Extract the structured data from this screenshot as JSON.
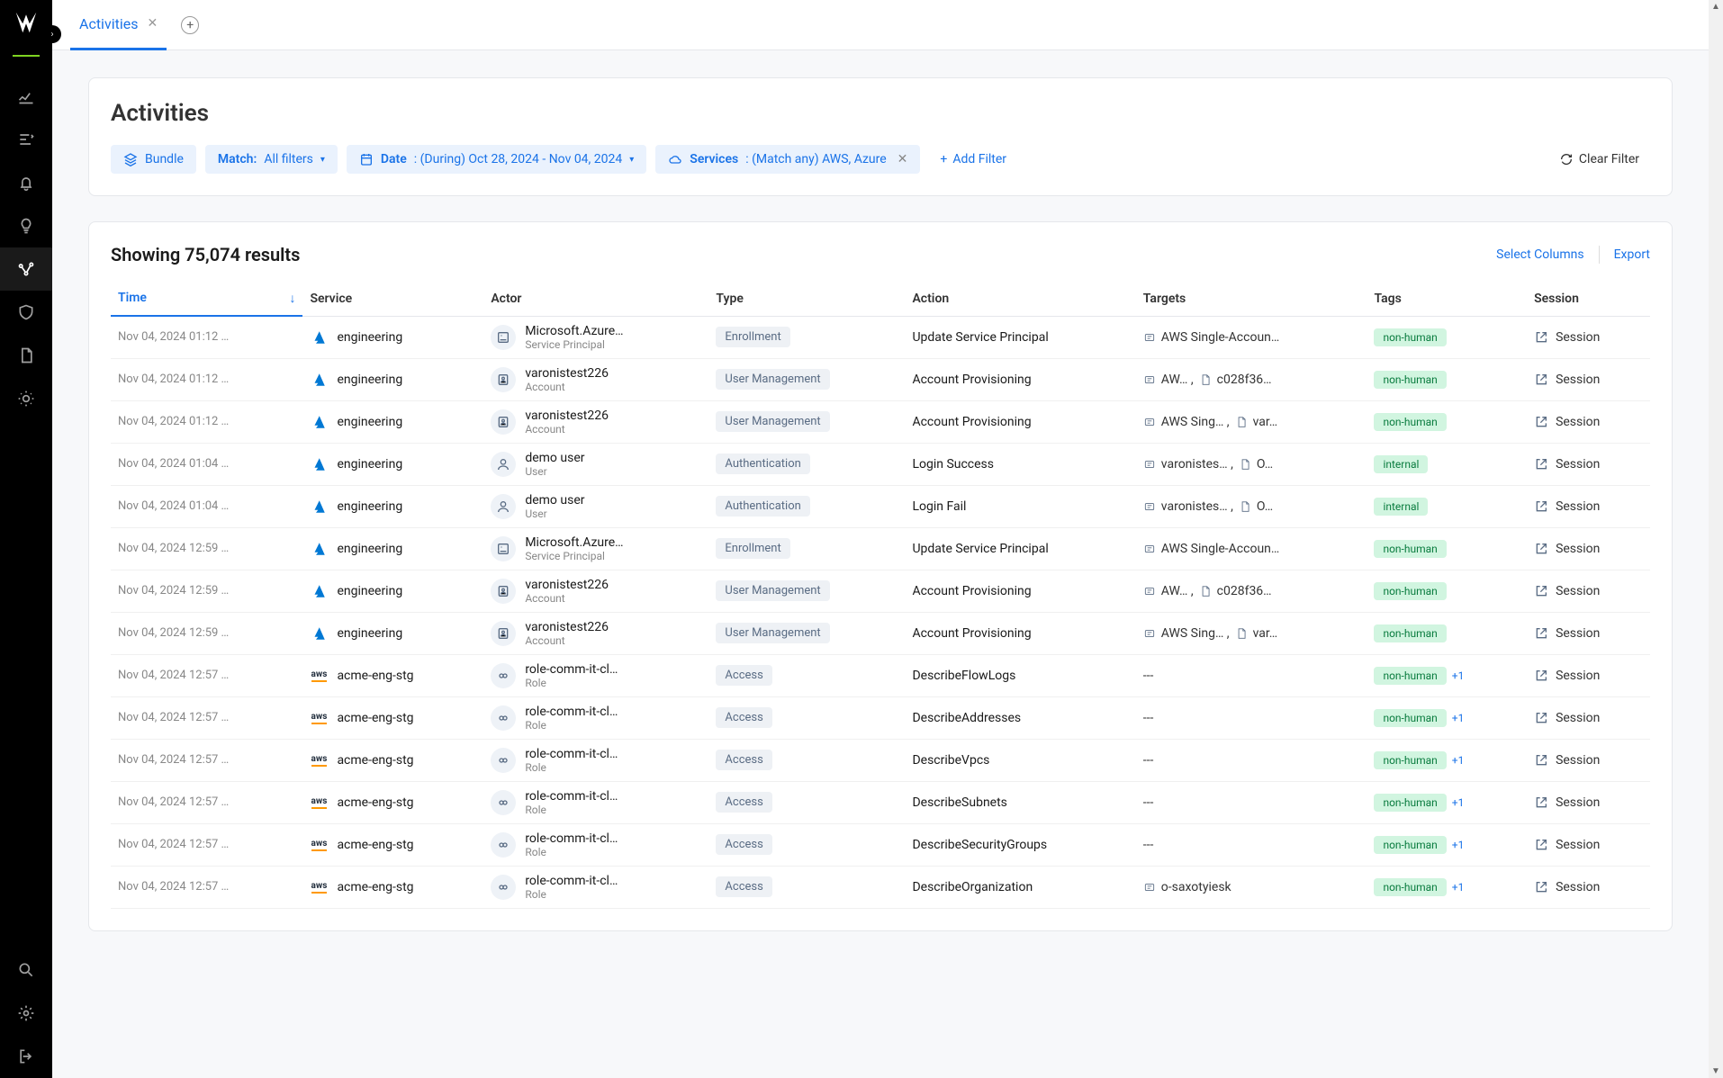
{
  "tab": {
    "label": "Activities"
  },
  "page": {
    "title": "Activities"
  },
  "filters": {
    "bundle": "Bundle",
    "match": {
      "label": "Match:",
      "value": "All filters"
    },
    "date": {
      "label": "Date",
      "value": ": (During) Oct 28, 2024 - Nov 04, 2024"
    },
    "services": {
      "label": "Services",
      "value": ": (Match any) AWS, Azure"
    },
    "add": "Add Filter",
    "clear": "Clear Filter"
  },
  "results": {
    "count_text": "Showing 75,074 results",
    "select_columns": "Select Columns",
    "export": "Export"
  },
  "columns": {
    "time": "Time",
    "service": "Service",
    "actor": "Actor",
    "type": "Type",
    "action": "Action",
    "targets": "Targets",
    "tags": "Tags",
    "session": "Session"
  },
  "session_label": "Session",
  "rows": [
    {
      "time": "Nov 04, 2024 01:12 …",
      "svc": "azure",
      "service": "engineering",
      "actor": "Microsoft.Azure…",
      "actor_sub": "Service Principal",
      "actor_icon": "app",
      "type": "Enrollment",
      "action": "Update Service Principal",
      "targets": "AWS Single-Accoun…",
      "targets2": "",
      "tag": "non-human",
      "plus": ""
    },
    {
      "time": "Nov 04, 2024 01:12 …",
      "svc": "azure",
      "service": "engineering",
      "actor": "varonistest226",
      "actor_sub": "Account",
      "actor_icon": "account",
      "type": "User Management",
      "action": "Account Provisioning",
      "targets": "AW…  ,",
      "targets2": "c028f36…",
      "tag": "non-human",
      "plus": ""
    },
    {
      "time": "Nov 04, 2024 01:12 …",
      "svc": "azure",
      "service": "engineering",
      "actor": "varonistest226",
      "actor_sub": "Account",
      "actor_icon": "account",
      "type": "User Management",
      "action": "Account Provisioning",
      "targets": "AWS Sing… ,",
      "targets2": "var…",
      "tag": "non-human",
      "plus": ""
    },
    {
      "time": "Nov 04, 2024 01:04 …",
      "svc": "azure",
      "service": "engineering",
      "actor": "demo user",
      "actor_sub": "User",
      "actor_icon": "user",
      "type": "Authentication",
      "action": "Login Success",
      "targets": "varonistes… ,",
      "targets2": "O…",
      "tag": "internal",
      "plus": ""
    },
    {
      "time": "Nov 04, 2024 01:04 …",
      "svc": "azure",
      "service": "engineering",
      "actor": "demo user",
      "actor_sub": "User",
      "actor_icon": "user",
      "type": "Authentication",
      "action": "Login Fail",
      "targets": "varonistes… ,",
      "targets2": "O…",
      "tag": "internal",
      "plus": ""
    },
    {
      "time": "Nov 04, 2024 12:59 …",
      "svc": "azure",
      "service": "engineering",
      "actor": "Microsoft.Azure…",
      "actor_sub": "Service Principal",
      "actor_icon": "app",
      "type": "Enrollment",
      "action": "Update Service Principal",
      "targets": "AWS Single-Accoun…",
      "targets2": "",
      "tag": "non-human",
      "plus": ""
    },
    {
      "time": "Nov 04, 2024 12:59 …",
      "svc": "azure",
      "service": "engineering",
      "actor": "varonistest226",
      "actor_sub": "Account",
      "actor_icon": "account",
      "type": "User Management",
      "action": "Account Provisioning",
      "targets": "AW… ,",
      "targets2": "c028f36…",
      "tag": "non-human",
      "plus": ""
    },
    {
      "time": "Nov 04, 2024 12:59 …",
      "svc": "azure",
      "service": "engineering",
      "actor": "varonistest226",
      "actor_sub": "Account",
      "actor_icon": "account",
      "type": "User Management",
      "action": "Account Provisioning",
      "targets": "AWS Sing… ,",
      "targets2": "var…",
      "tag": "non-human",
      "plus": ""
    },
    {
      "time": "Nov 04, 2024 12:57 …",
      "svc": "aws",
      "service": "acme-eng-stg",
      "actor": "role-comm-it-cl…",
      "actor_sub": "Role",
      "actor_icon": "role",
      "type": "Access",
      "action": "DescribeFlowLogs",
      "targets": "---",
      "targets2": "",
      "tag": "non-human",
      "plus": "+1"
    },
    {
      "time": "Nov 04, 2024 12:57 …",
      "svc": "aws",
      "service": "acme-eng-stg",
      "actor": "role-comm-it-cl…",
      "actor_sub": "Role",
      "actor_icon": "role",
      "type": "Access",
      "action": "DescribeAddresses",
      "targets": "---",
      "targets2": "",
      "tag": "non-human",
      "plus": "+1"
    },
    {
      "time": "Nov 04, 2024 12:57 …",
      "svc": "aws",
      "service": "acme-eng-stg",
      "actor": "role-comm-it-cl…",
      "actor_sub": "Role",
      "actor_icon": "role",
      "type": "Access",
      "action": "DescribeVpcs",
      "targets": "---",
      "targets2": "",
      "tag": "non-human",
      "plus": "+1"
    },
    {
      "time": "Nov 04, 2024 12:57 …",
      "svc": "aws",
      "service": "acme-eng-stg",
      "actor": "role-comm-it-cl…",
      "actor_sub": "Role",
      "actor_icon": "role",
      "type": "Access",
      "action": "DescribeSubnets",
      "targets": "---",
      "targets2": "",
      "tag": "non-human",
      "plus": "+1"
    },
    {
      "time": "Nov 04, 2024 12:57 …",
      "svc": "aws",
      "service": "acme-eng-stg",
      "actor": "role-comm-it-cl…",
      "actor_sub": "Role",
      "actor_icon": "role",
      "type": "Access",
      "action": "DescribeSecurityGroups",
      "targets": "---",
      "targets2": "",
      "tag": "non-human",
      "plus": "+1"
    },
    {
      "time": "Nov 04, 2024 12:57 …",
      "svc": "aws",
      "service": "acme-eng-stg",
      "actor": "role-comm-it-cl…",
      "actor_sub": "Role",
      "actor_icon": "role",
      "type": "Access",
      "action": "DescribeOrganization",
      "targets": "o-saxotyiesk",
      "targets2": "",
      "tag": "non-human",
      "plus": "+1"
    }
  ]
}
